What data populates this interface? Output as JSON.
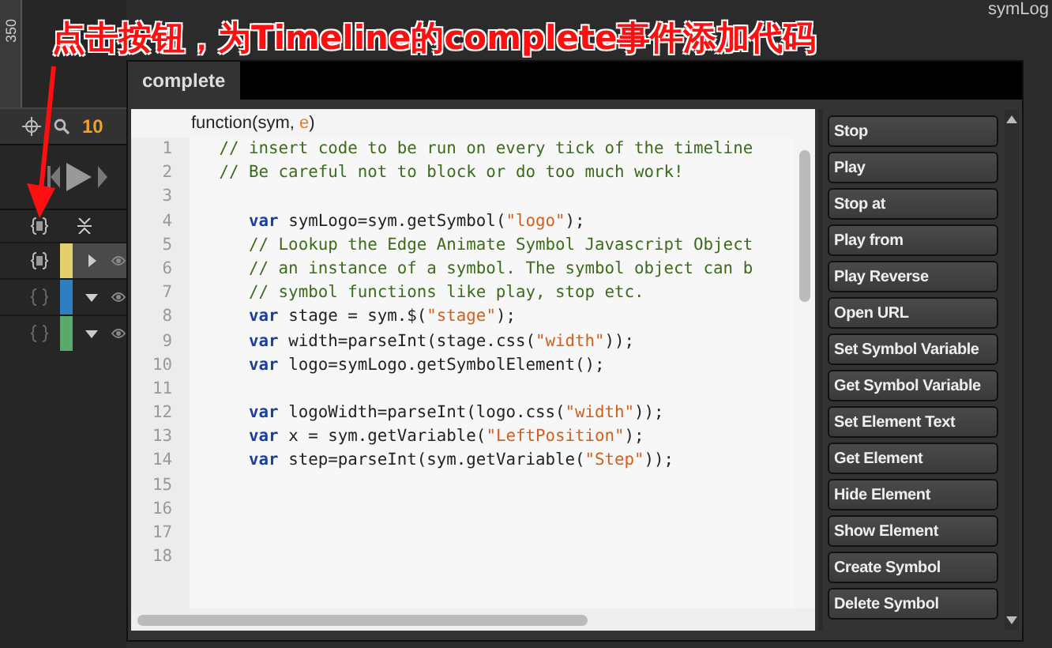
{
  "annotation": {
    "text": "点击按钮，为Timeline的complete事件添加代码"
  },
  "stage": {
    "ruler_label": "350",
    "zoom": "10",
    "layer_label": "symLog"
  },
  "timeline": {
    "rows": [
      {
        "color": "#e3cf6b",
        "expanded": false,
        "has_action": true
      },
      {
        "color": "#2f7ec1",
        "expanded": true,
        "has_action": false
      },
      {
        "color": "#5aa86a",
        "expanded": true,
        "has_action": false
      }
    ]
  },
  "dialog": {
    "tab": {
      "label": "complete",
      "selected": true
    },
    "signature": [
      {
        "kind": "plain",
        "text": "function(sym, "
      },
      {
        "kind": "param",
        "text": "e"
      },
      {
        "kind": "plain",
        "text": ")"
      }
    ],
    "code": [
      {
        "number": "1",
        "tokens": [
          {
            "kind": "comment",
            "text": "   // insert code to be run on every tick of the timeline"
          }
        ]
      },
      {
        "number": "2",
        "tokens": [
          {
            "kind": "comment",
            "text": "   // Be careful not to block or do too much work!"
          }
        ]
      },
      {
        "number": "3"
      },
      {
        "number": "4",
        "tokens": [
          {
            "kind": "keyword",
            "text": "      var"
          },
          {
            "kind": "plain",
            "text": " symLogo=sym.getSymbol("
          },
          {
            "kind": "string",
            "text": "\"logo\""
          },
          {
            "kind": "plain",
            "text": ");"
          }
        ]
      },
      {
        "number": "5",
        "tokens": [
          {
            "kind": "comment",
            "text": "      // Lookup the Edge Animate Symbol Javascript Object"
          }
        ]
      },
      {
        "number": "6",
        "tokens": [
          {
            "kind": "comment",
            "text": "      // an instance of a symbol. The symbol object can b"
          }
        ]
      },
      {
        "number": "7",
        "tokens": [
          {
            "kind": "comment",
            "text": "      // symbol functions like play, stop etc."
          }
        ]
      },
      {
        "number": "8",
        "tokens": [
          {
            "kind": "keyword",
            "text": "      var"
          },
          {
            "kind": "plain",
            "text": " stage = sym.$("
          },
          {
            "kind": "string",
            "text": "\"stage\""
          },
          {
            "kind": "plain",
            "text": ");"
          }
        ]
      },
      {
        "number": "9",
        "tokens": [
          {
            "kind": "keyword",
            "text": "      var"
          },
          {
            "kind": "plain",
            "text": " width=parseInt(stage.css("
          },
          {
            "kind": "string",
            "text": "\"width\""
          },
          {
            "kind": "plain",
            "text": "));"
          }
        ]
      },
      {
        "number": "10",
        "tokens": [
          {
            "kind": "keyword",
            "text": "      var"
          },
          {
            "kind": "plain",
            "text": " logo=symLogo.getSymbolElement();"
          }
        ]
      },
      {
        "number": "11"
      },
      {
        "number": "12",
        "tokens": [
          {
            "kind": "keyword",
            "text": "      var"
          },
          {
            "kind": "plain",
            "text": " logoWidth=parseInt(logo.css("
          },
          {
            "kind": "string",
            "text": "\"width\""
          },
          {
            "kind": "plain",
            "text": "));"
          }
        ]
      },
      {
        "number": "13",
        "tokens": [
          {
            "kind": "keyword",
            "text": "      var"
          },
          {
            "kind": "plain",
            "text": " x = sym.getVariable("
          },
          {
            "kind": "string",
            "text": "\"LeftPosition\""
          },
          {
            "kind": "plain",
            "text": ");"
          }
        ]
      },
      {
        "number": "14",
        "tokens": [
          {
            "kind": "keyword",
            "text": "      var"
          },
          {
            "kind": "plain",
            "text": " step=parseInt(sym.getVariable("
          },
          {
            "kind": "string",
            "text": "\"Step\""
          },
          {
            "kind": "plain",
            "text": "));"
          }
        ]
      },
      {
        "number": "15"
      },
      {
        "number": "16"
      },
      {
        "number": "17"
      },
      {
        "number": "18"
      }
    ],
    "actions": [
      "Stop",
      "Play",
      "Stop at",
      "Play from",
      "Play Reverse",
      "Open URL",
      "Set Symbol Variable",
      "Get Symbol Variable",
      "Set Element Text",
      "Get Element",
      "Hide Element",
      "Show Element",
      "Create Symbol",
      "Delete Symbol"
    ]
  }
}
